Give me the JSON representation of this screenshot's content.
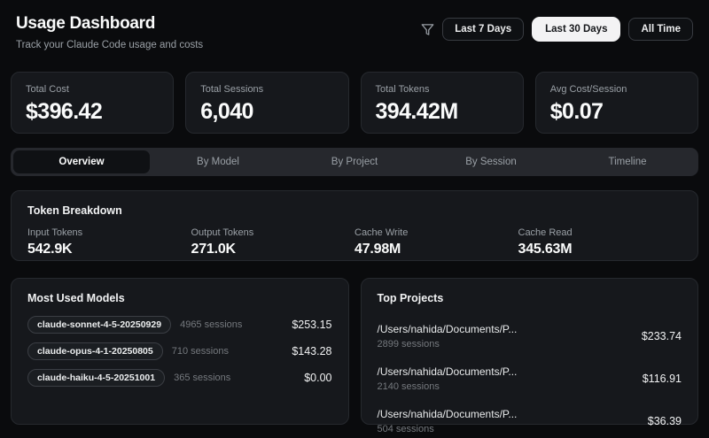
{
  "header": {
    "title": "Usage Dashboard",
    "subtitle": "Track your Claude Code usage and costs",
    "range_buttons": [
      {
        "label": "Last 7 Days",
        "active": false
      },
      {
        "label": "Last 30 Days",
        "active": true
      },
      {
        "label": "All Time",
        "active": false
      }
    ]
  },
  "stats": [
    {
      "label": "Total Cost",
      "value": "$396.42"
    },
    {
      "label": "Total Sessions",
      "value": "6,040"
    },
    {
      "label": "Total Tokens",
      "value": "394.42M"
    },
    {
      "label": "Avg Cost/Session",
      "value": "$0.07"
    }
  ],
  "tabs": [
    {
      "label": "Overview",
      "active": true
    },
    {
      "label": "By Model",
      "active": false
    },
    {
      "label": "By Project",
      "active": false
    },
    {
      "label": "By Session",
      "active": false
    },
    {
      "label": "Timeline",
      "active": false
    }
  ],
  "token_breakdown": {
    "title": "Token Breakdown",
    "items": [
      {
        "label": "Input Tokens",
        "value": "542.9K"
      },
      {
        "label": "Output Tokens",
        "value": "271.0K"
      },
      {
        "label": "Cache Write",
        "value": "47.98M"
      },
      {
        "label": "Cache Read",
        "value": "345.63M"
      }
    ]
  },
  "most_used_models": {
    "title": "Most Used Models",
    "rows": [
      {
        "model": "claude-sonnet-4-5-20250929",
        "sessions": "4965 sessions",
        "cost": "$253.15"
      },
      {
        "model": "claude-opus-4-1-20250805",
        "sessions": "710 sessions",
        "cost": "$143.28"
      },
      {
        "model": "claude-haiku-4-5-20251001",
        "sessions": "365 sessions",
        "cost": "$0.00"
      }
    ]
  },
  "top_projects": {
    "title": "Top Projects",
    "rows": [
      {
        "path": "/Users/nahida/Documents/P...",
        "sessions": "2899 sessions",
        "cost": "$233.74"
      },
      {
        "path": "/Users/nahida/Documents/P...",
        "sessions": "2140 sessions",
        "cost": "$116.91"
      },
      {
        "path": "/Users/nahida/Documents/P...",
        "sessions": "504 sessions",
        "cost": "$36.39"
      }
    ]
  },
  "icons": {
    "filter": "funnel-icon"
  },
  "colors": {
    "background": "#0a0b0d",
    "card": "#16181c",
    "card_border": "#26292e",
    "muted_text": "#9aa0a6",
    "active_button_bg": "#f3f3f4",
    "tab_bar_bg": "#26282d",
    "active_tab_bg": "#0f1114"
  }
}
